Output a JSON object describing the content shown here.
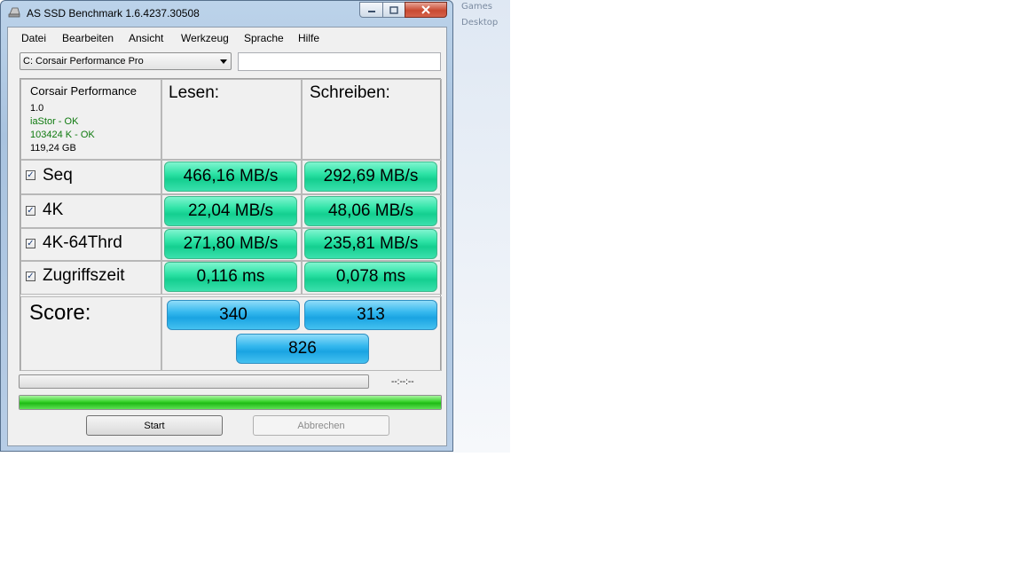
{
  "window": {
    "title": "AS SSD Benchmark 1.6.4237.30508"
  },
  "background": {
    "items": [
      "Games",
      "Desktop"
    ]
  },
  "menu": {
    "items": [
      "Datei",
      "Bearbeiten",
      "Ansicht",
      "Werkzeug",
      "Sprache",
      "Hilfe"
    ]
  },
  "drive_select": {
    "value": "C: Corsair Performance Pro"
  },
  "drive_info": {
    "name": "Corsair Performance",
    "firmware": "1.0",
    "driver_status": "iaStor - OK",
    "alignment_status": "103424 K - OK",
    "capacity": "119,24 GB"
  },
  "columns": {
    "read": "Lesen:",
    "write": "Schreiben:"
  },
  "rows": [
    {
      "label": "Seq",
      "checked": true,
      "read": "466,16 MB/s",
      "write": "292,69 MB/s"
    },
    {
      "label": "4K",
      "checked": true,
      "read": "22,04 MB/s",
      "write": "48,06 MB/s"
    },
    {
      "label": "4K-64Thrd",
      "checked": true,
      "read": "271,80 MB/s",
      "write": "235,81 MB/s"
    },
    {
      "label": "Zugriffszeit",
      "checked": true,
      "read": "0,116 ms",
      "write": "0,078 ms"
    }
  ],
  "score": {
    "label": "Score:",
    "read": "340",
    "write": "313",
    "total": "826"
  },
  "progress": {
    "time": "--:--:--",
    "test_progress": 0,
    "overall_progress": 100
  },
  "buttons": {
    "start": "Start",
    "cancel": "Abbrechen"
  },
  "colors": {
    "result_green": "#2ee3a6",
    "score_blue": "#35b8ee",
    "progress_green": "#37d22a",
    "ok_text": "#0f7a0f"
  }
}
